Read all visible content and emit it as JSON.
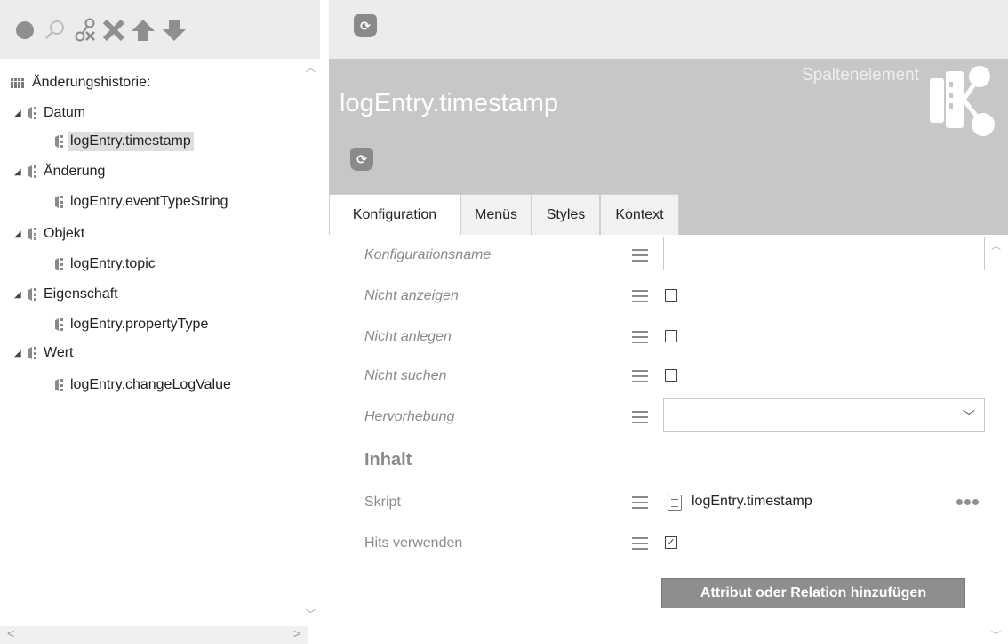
{
  "toolbar": {
    "icons": [
      "record-icon",
      "search-icon",
      "link-remove-icon",
      "delete-icon",
      "move-up-icon",
      "move-down-icon"
    ]
  },
  "tree": {
    "root_label": "Änderungshistorie:",
    "groups": [
      {
        "label": "Datum",
        "child": "logEntry.timestamp",
        "selected": true
      },
      {
        "label": "Änderung",
        "child": "logEntry.eventTypeString"
      },
      {
        "label": "Objekt",
        "child": "logEntry.topic"
      },
      {
        "label": "Eigenschaft",
        "child": "logEntry.propertyType"
      },
      {
        "label": "Wert",
        "child": "logEntry.changeLogValue"
      }
    ]
  },
  "header": {
    "element_type": "Spaltenelement",
    "title": "logEntry.timestamp"
  },
  "tabs": [
    "Konfiguration",
    "Menüs",
    "Styles",
    "Kontext"
  ],
  "active_tab": "Konfiguration",
  "form": {
    "config_name_label": "Konfigurationsname",
    "config_name_value": "",
    "not_show_label": "Nicht anzeigen",
    "not_show_checked": false,
    "not_create_label": "Nicht anlegen",
    "not_create_checked": false,
    "not_search_label": "Nicht suchen",
    "not_search_checked": false,
    "highlight_label": "Hervorhebung",
    "highlight_value": "",
    "section_heading": "Inhalt",
    "script_label": "Skript",
    "script_value": "logEntry.timestamp",
    "hits_label": "Hits verwenden",
    "hits_checked": true,
    "add_button_label": "Attribut oder Relation hinzufügen"
  },
  "colors": {
    "toolbar_bg": "#ececec",
    "header_bg": "#c7c7c7",
    "icon_gray": "#8a8a8a",
    "button_bg": "#8e8e8e"
  }
}
